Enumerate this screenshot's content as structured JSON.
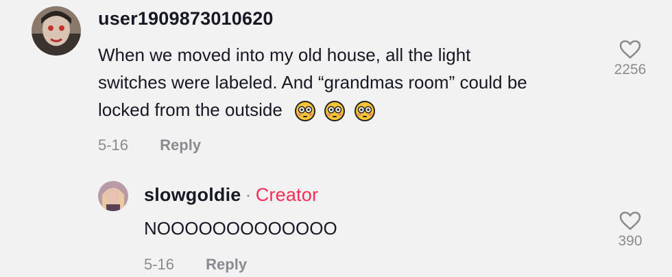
{
  "comments": [
    {
      "username": "user1909873010620",
      "text_lines": [
        "When we moved into my old house, all the light",
        "switches were labeled. And “grandmas room” could be",
        "locked from the outside"
      ],
      "emoji": [
        "flushed-face",
        "flushed-face",
        "flushed-face"
      ],
      "date": "5-16",
      "reply_label": "Reply",
      "likes": "2256"
    },
    {
      "username": "slowgoldie",
      "separator": "·",
      "badge": "Creator",
      "text": "NOOOOOOOOOOOOO",
      "date": "5-16",
      "reply_label": "Reply",
      "likes": "390"
    }
  ],
  "colors": {
    "background": "#f2f2f2",
    "text": "#161823",
    "muted": "#8a8b91",
    "creator": "#fe2c55"
  }
}
